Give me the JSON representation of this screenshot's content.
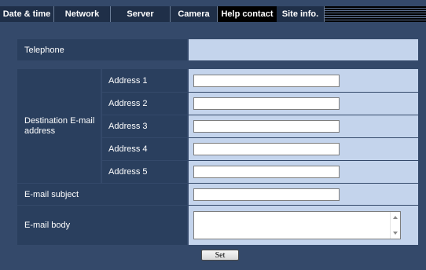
{
  "tabs": [
    {
      "label": "Date & time",
      "active": false
    },
    {
      "label": "Network",
      "active": false
    },
    {
      "label": "Server",
      "active": false
    },
    {
      "label": "Camera",
      "active": false
    },
    {
      "label": "Help contact",
      "active": true
    },
    {
      "label": "Site info.",
      "active": false
    }
  ],
  "form": {
    "telephone_label": "Telephone",
    "destination_label": "Destination E-mail address",
    "addresses": [
      {
        "label": "Address 1",
        "value": ""
      },
      {
        "label": "Address 2",
        "value": ""
      },
      {
        "label": "Address 3",
        "value": ""
      },
      {
        "label": "Address 4",
        "value": ""
      },
      {
        "label": "Address 5",
        "value": ""
      }
    ],
    "subject_label": "E-mail subject",
    "subject_value": "",
    "body_label": "E-mail body",
    "body_value": ""
  },
  "buttons": {
    "set_label": "Set"
  },
  "colors": {
    "background": "#34496a",
    "label_cell": "#2a3f5e",
    "value_cell": "#c4d4ec",
    "tab_bar": "#000000"
  }
}
